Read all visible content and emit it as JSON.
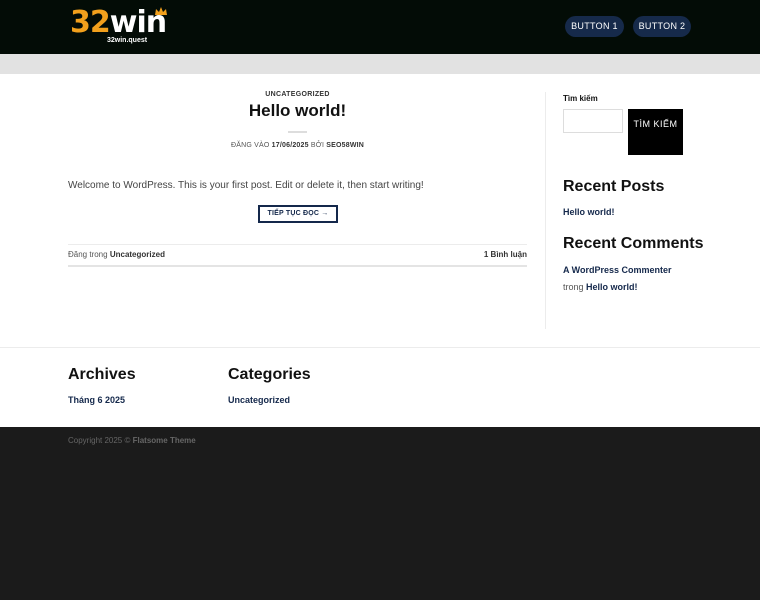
{
  "header": {
    "logo": {
      "number": "32",
      "word": "win",
      "sub": "32win.quest"
    },
    "buttons": [
      "BUTTON 1",
      "BUTTON 2"
    ]
  },
  "post": {
    "category": "UNCATEGORIZED",
    "title": "Hello world!",
    "meta_prefix": "ĐĂNG VÀO",
    "meta_date": "17/06/2025",
    "meta_by": "BỞI",
    "meta_author": "SEO58WIN",
    "excerpt": "Welcome to WordPress. This is your first post. Edit or delete it, then start writing!",
    "read_more": "TIẾP TỤC ĐỌC →",
    "posted_in_prefix": "Đăng trong",
    "posted_in_category": "Uncategorized",
    "comments_count": "1",
    "comments_label": "Bình luận"
  },
  "sidebar": {
    "search_label": "Tìm kiếm",
    "search_button": "TÌM KIẾM",
    "recent_posts_title": "Recent Posts",
    "recent_posts": [
      "Hello world!"
    ],
    "recent_comments_title": "Recent Comments",
    "recent_comment_author": "A WordPress Commenter",
    "recent_comment_on": "trong",
    "recent_comment_post": "Hello world!"
  },
  "bottom": {
    "archives_title": "Archives",
    "archives_link": "Tháng 6 2025",
    "categories_title": "Categories",
    "categories_link": "Uncategorized"
  },
  "footer": {
    "copyright_prefix": "Copyright 2025 ©",
    "copyright_theme": "Flatsome Theme"
  },
  "colors": {
    "header_bg": "#030c06",
    "logo_accent": "#f2a01c",
    "button_bg": "#162a4a",
    "link": "#14284b",
    "footer_bg": "#1b1b1b"
  }
}
